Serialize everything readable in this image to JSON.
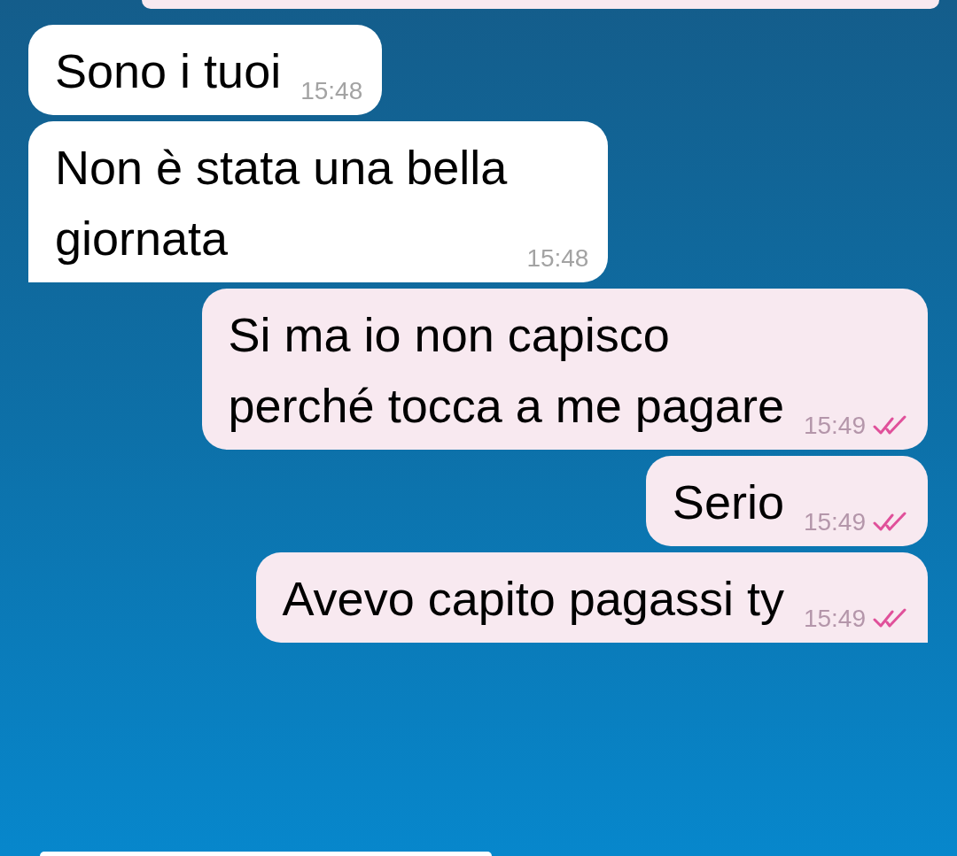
{
  "messages": [
    {
      "kind": "incoming",
      "text": "Sono i tuoi",
      "time": "15:48",
      "tail": false
    },
    {
      "kind": "incoming",
      "text": "Non è stata una bella\ngiornata",
      "time": "15:48",
      "tail": true
    },
    {
      "kind": "outgoing",
      "text": "Si ma io non capisco\nperché tocca a me pagare",
      "time": "15:49",
      "read": true,
      "tail": false
    },
    {
      "kind": "outgoing",
      "text": "Serio",
      "time": "15:49",
      "read": true,
      "tail": false
    },
    {
      "kind": "outgoing",
      "text": "Avevo capito pagassi ty",
      "time": "15:49",
      "read": true,
      "tail": true
    }
  ]
}
